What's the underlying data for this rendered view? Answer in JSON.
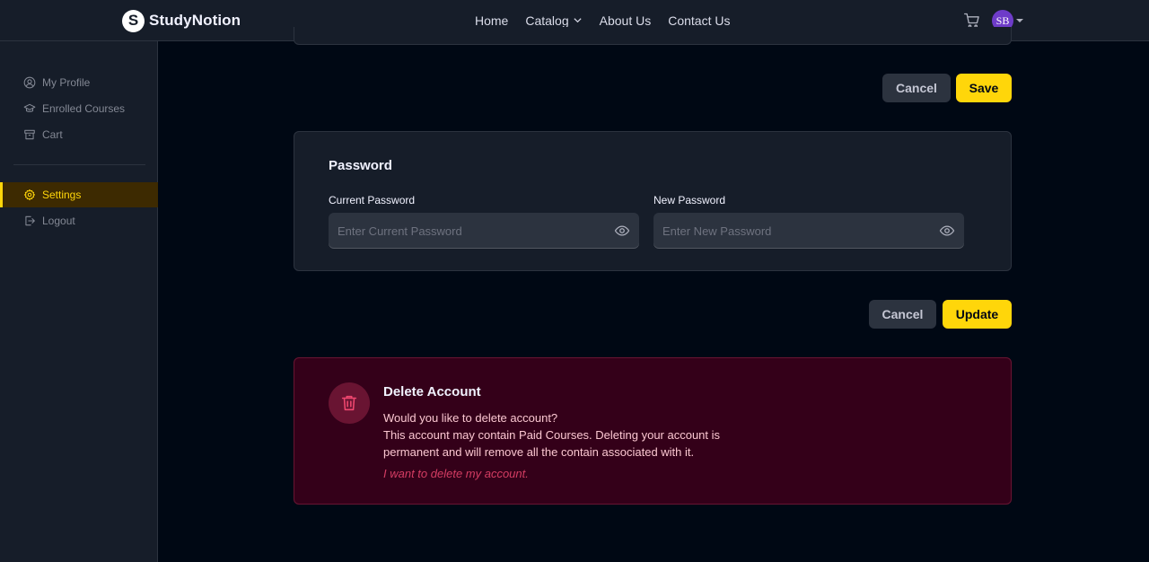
{
  "brand": {
    "name": "StudyNotion",
    "mark": "S"
  },
  "nav": {
    "links": [
      "Home",
      "Catalog",
      "About Us",
      "Contact Us"
    ],
    "avatar_initials": "SB"
  },
  "sidebar": {
    "items": [
      {
        "label": "My Profile",
        "icon": "user-circle-icon"
      },
      {
        "label": "Enrolled Courses",
        "icon": "graduation-cap-icon"
      },
      {
        "label": "Cart",
        "icon": "archive-icon"
      },
      {
        "label": "Settings",
        "icon": "gear-icon",
        "active": true
      },
      {
        "label": "Logout",
        "icon": "logout-icon"
      }
    ]
  },
  "profile_actions": {
    "cancel": "Cancel",
    "save": "Save"
  },
  "password": {
    "title": "Password",
    "current_label": "Current Password",
    "current_placeholder": "Enter Current Password",
    "new_label": "New Password",
    "new_placeholder": "Enter New Password"
  },
  "password_actions": {
    "cancel": "Cancel",
    "update": "Update"
  },
  "delete_account": {
    "title": "Delete Account",
    "lines": [
      "Would you like to delete account?",
      "This account may contain Paid Courses. Deleting your account is",
      "permanent and will remove all the contain associated with it."
    ],
    "link": "I want to delete my account."
  },
  "colors": {
    "accent": "#FFD60A",
    "background": "#000814",
    "panel": "#161D29",
    "danger_bg": "#340019",
    "danger_link": "#D43D63",
    "avatar": "#6E3CC9"
  }
}
